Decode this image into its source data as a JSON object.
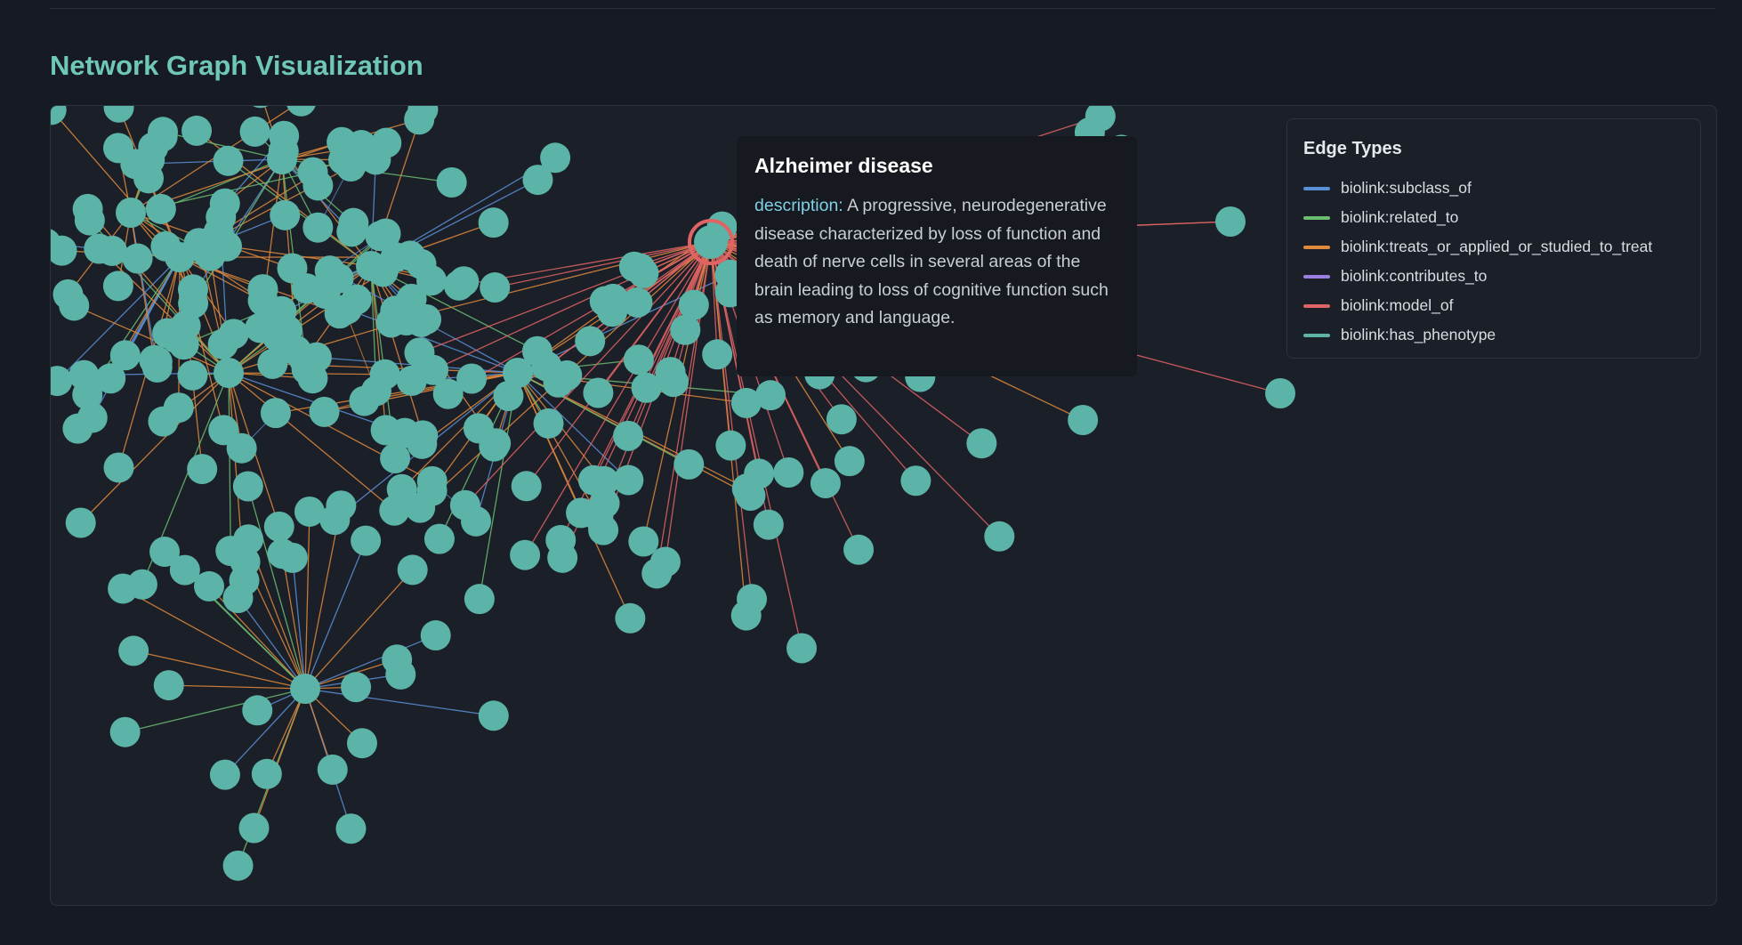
{
  "page": {
    "title": "Network Graph Visualization"
  },
  "tooltip": {
    "title": "Alzheimer disease",
    "field_label": "description:",
    "field_value": "A progressive, neurodegenerative disease characterized by loss of function and death of nerve cells in several areas of the brain leading to loss of cognitive function such as memory and language."
  },
  "legend": {
    "title": "Edge Types",
    "items": [
      {
        "label": "biolink:subclass_of",
        "color": "#5b8fd6"
      },
      {
        "label": "biolink:related_to",
        "color": "#6bbd72"
      },
      {
        "label": "biolink:treats_or_applied_or_studied_to_treat",
        "color": "#e08a3c"
      },
      {
        "label": "biolink:contributes_to",
        "color": "#9b7ee0"
      },
      {
        "label": "biolink:model_of",
        "color": "#e06464"
      },
      {
        "label": "biolink:has_phenotype",
        "color": "#5fb3a6"
      }
    ]
  },
  "graph": {
    "node_color": "#5cb3a8",
    "highlight_node_label": "Alzheimer disease",
    "highlight_color": "#e06464"
  }
}
